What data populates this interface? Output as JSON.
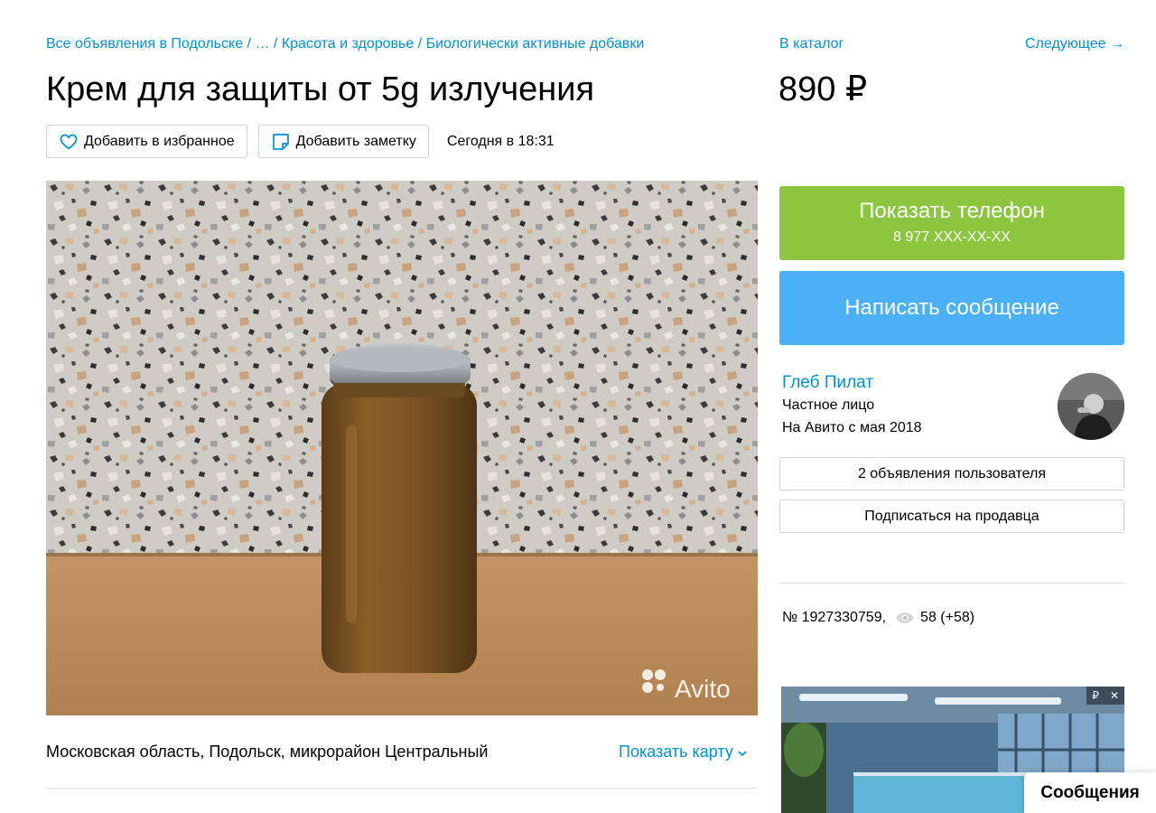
{
  "breadcrumbs": {
    "items": [
      "Все объявления в Подольске",
      "…",
      "Красота и здоровье",
      "Биологически активные добавки"
    ],
    "separator": " / "
  },
  "title": "Крем для защиты от 5g излучения",
  "actions": {
    "favorite_label": "Добавить в избранное",
    "note_label": "Добавить заметку",
    "date": "Сегодня в 18:31"
  },
  "nav": {
    "catalog": "В каталог",
    "next": "Следующее →"
  },
  "price": "890 ₽",
  "contact": {
    "phone_label": "Показать телефон",
    "phone_masked": "8 977 XXX-XX-XX",
    "message_label": "Написать сообщение"
  },
  "seller": {
    "name": "Глеб Пилат",
    "type": "Частное лицо",
    "since": "На Авито с мая 2018",
    "ads_button": "2 объявления пользователя",
    "subscribe_button": "Подписаться на продавца"
  },
  "item": {
    "number": "№ 1927330759,",
    "views": "58 (+58)"
  },
  "photo": {
    "watermark": "Avito"
  },
  "location": {
    "address": "Московская область, Подольск, микрорайон Центральный",
    "map_link": "Показать карту"
  },
  "ad": {
    "ruble_badge": "₽",
    "close": "✕"
  },
  "messages_tab": "Сообщения",
  "colors": {
    "link": "#0091d9",
    "phone_button": "#8cc63f",
    "message_button": "#4bb0f5"
  }
}
